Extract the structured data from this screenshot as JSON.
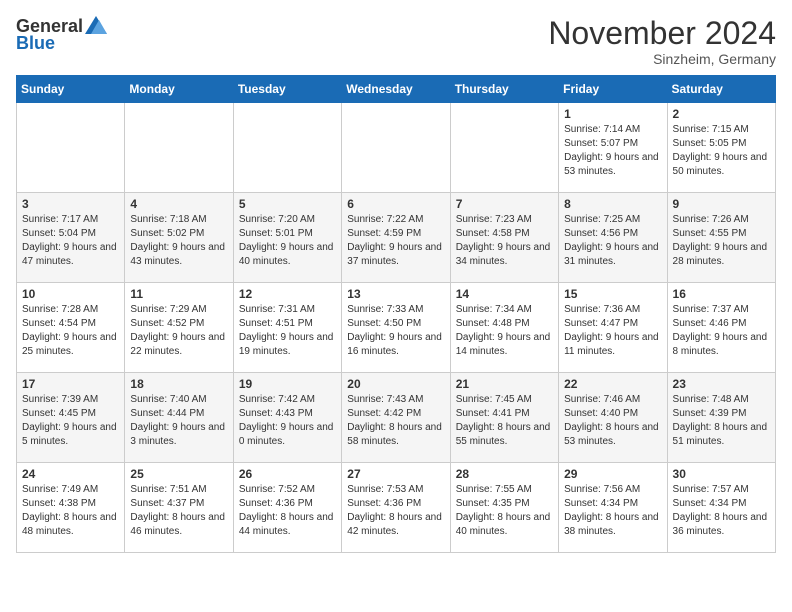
{
  "header": {
    "logo_general": "General",
    "logo_blue": "Blue",
    "month_title": "November 2024",
    "location": "Sinzheim, Germany"
  },
  "days_of_week": [
    "Sunday",
    "Monday",
    "Tuesday",
    "Wednesday",
    "Thursday",
    "Friday",
    "Saturday"
  ],
  "weeks": [
    {
      "days": [
        {
          "num": "",
          "sunrise": "",
          "sunset": "",
          "daylight": ""
        },
        {
          "num": "",
          "sunrise": "",
          "sunset": "",
          "daylight": ""
        },
        {
          "num": "",
          "sunrise": "",
          "sunset": "",
          "daylight": ""
        },
        {
          "num": "",
          "sunrise": "",
          "sunset": "",
          "daylight": ""
        },
        {
          "num": "",
          "sunrise": "",
          "sunset": "",
          "daylight": ""
        },
        {
          "num": "1",
          "sunrise": "Sunrise: 7:14 AM",
          "sunset": "Sunset: 5:07 PM",
          "daylight": "Daylight: 9 hours and 53 minutes."
        },
        {
          "num": "2",
          "sunrise": "Sunrise: 7:15 AM",
          "sunset": "Sunset: 5:05 PM",
          "daylight": "Daylight: 9 hours and 50 minutes."
        }
      ]
    },
    {
      "days": [
        {
          "num": "3",
          "sunrise": "Sunrise: 7:17 AM",
          "sunset": "Sunset: 5:04 PM",
          "daylight": "Daylight: 9 hours and 47 minutes."
        },
        {
          "num": "4",
          "sunrise": "Sunrise: 7:18 AM",
          "sunset": "Sunset: 5:02 PM",
          "daylight": "Daylight: 9 hours and 43 minutes."
        },
        {
          "num": "5",
          "sunrise": "Sunrise: 7:20 AM",
          "sunset": "Sunset: 5:01 PM",
          "daylight": "Daylight: 9 hours and 40 minutes."
        },
        {
          "num": "6",
          "sunrise": "Sunrise: 7:22 AM",
          "sunset": "Sunset: 4:59 PM",
          "daylight": "Daylight: 9 hours and 37 minutes."
        },
        {
          "num": "7",
          "sunrise": "Sunrise: 7:23 AM",
          "sunset": "Sunset: 4:58 PM",
          "daylight": "Daylight: 9 hours and 34 minutes."
        },
        {
          "num": "8",
          "sunrise": "Sunrise: 7:25 AM",
          "sunset": "Sunset: 4:56 PM",
          "daylight": "Daylight: 9 hours and 31 minutes."
        },
        {
          "num": "9",
          "sunrise": "Sunrise: 7:26 AM",
          "sunset": "Sunset: 4:55 PM",
          "daylight": "Daylight: 9 hours and 28 minutes."
        }
      ]
    },
    {
      "days": [
        {
          "num": "10",
          "sunrise": "Sunrise: 7:28 AM",
          "sunset": "Sunset: 4:54 PM",
          "daylight": "Daylight: 9 hours and 25 minutes."
        },
        {
          "num": "11",
          "sunrise": "Sunrise: 7:29 AM",
          "sunset": "Sunset: 4:52 PM",
          "daylight": "Daylight: 9 hours and 22 minutes."
        },
        {
          "num": "12",
          "sunrise": "Sunrise: 7:31 AM",
          "sunset": "Sunset: 4:51 PM",
          "daylight": "Daylight: 9 hours and 19 minutes."
        },
        {
          "num": "13",
          "sunrise": "Sunrise: 7:33 AM",
          "sunset": "Sunset: 4:50 PM",
          "daylight": "Daylight: 9 hours and 16 minutes."
        },
        {
          "num": "14",
          "sunrise": "Sunrise: 7:34 AM",
          "sunset": "Sunset: 4:48 PM",
          "daylight": "Daylight: 9 hours and 14 minutes."
        },
        {
          "num": "15",
          "sunrise": "Sunrise: 7:36 AM",
          "sunset": "Sunset: 4:47 PM",
          "daylight": "Daylight: 9 hours and 11 minutes."
        },
        {
          "num": "16",
          "sunrise": "Sunrise: 7:37 AM",
          "sunset": "Sunset: 4:46 PM",
          "daylight": "Daylight: 9 hours and 8 minutes."
        }
      ]
    },
    {
      "days": [
        {
          "num": "17",
          "sunrise": "Sunrise: 7:39 AM",
          "sunset": "Sunset: 4:45 PM",
          "daylight": "Daylight: 9 hours and 5 minutes."
        },
        {
          "num": "18",
          "sunrise": "Sunrise: 7:40 AM",
          "sunset": "Sunset: 4:44 PM",
          "daylight": "Daylight: 9 hours and 3 minutes."
        },
        {
          "num": "19",
          "sunrise": "Sunrise: 7:42 AM",
          "sunset": "Sunset: 4:43 PM",
          "daylight": "Daylight: 9 hours and 0 minutes."
        },
        {
          "num": "20",
          "sunrise": "Sunrise: 7:43 AM",
          "sunset": "Sunset: 4:42 PM",
          "daylight": "Daylight: 8 hours and 58 minutes."
        },
        {
          "num": "21",
          "sunrise": "Sunrise: 7:45 AM",
          "sunset": "Sunset: 4:41 PM",
          "daylight": "Daylight: 8 hours and 55 minutes."
        },
        {
          "num": "22",
          "sunrise": "Sunrise: 7:46 AM",
          "sunset": "Sunset: 4:40 PM",
          "daylight": "Daylight: 8 hours and 53 minutes."
        },
        {
          "num": "23",
          "sunrise": "Sunrise: 7:48 AM",
          "sunset": "Sunset: 4:39 PM",
          "daylight": "Daylight: 8 hours and 51 minutes."
        }
      ]
    },
    {
      "days": [
        {
          "num": "24",
          "sunrise": "Sunrise: 7:49 AM",
          "sunset": "Sunset: 4:38 PM",
          "daylight": "Daylight: 8 hours and 48 minutes."
        },
        {
          "num": "25",
          "sunrise": "Sunrise: 7:51 AM",
          "sunset": "Sunset: 4:37 PM",
          "daylight": "Daylight: 8 hours and 46 minutes."
        },
        {
          "num": "26",
          "sunrise": "Sunrise: 7:52 AM",
          "sunset": "Sunset: 4:36 PM",
          "daylight": "Daylight: 8 hours and 44 minutes."
        },
        {
          "num": "27",
          "sunrise": "Sunrise: 7:53 AM",
          "sunset": "Sunset: 4:36 PM",
          "daylight": "Daylight: 8 hours and 42 minutes."
        },
        {
          "num": "28",
          "sunrise": "Sunrise: 7:55 AM",
          "sunset": "Sunset: 4:35 PM",
          "daylight": "Daylight: 8 hours and 40 minutes."
        },
        {
          "num": "29",
          "sunrise": "Sunrise: 7:56 AM",
          "sunset": "Sunset: 4:34 PM",
          "daylight": "Daylight: 8 hours and 38 minutes."
        },
        {
          "num": "30",
          "sunrise": "Sunrise: 7:57 AM",
          "sunset": "Sunset: 4:34 PM",
          "daylight": "Daylight: 8 hours and 36 minutes."
        }
      ]
    }
  ]
}
